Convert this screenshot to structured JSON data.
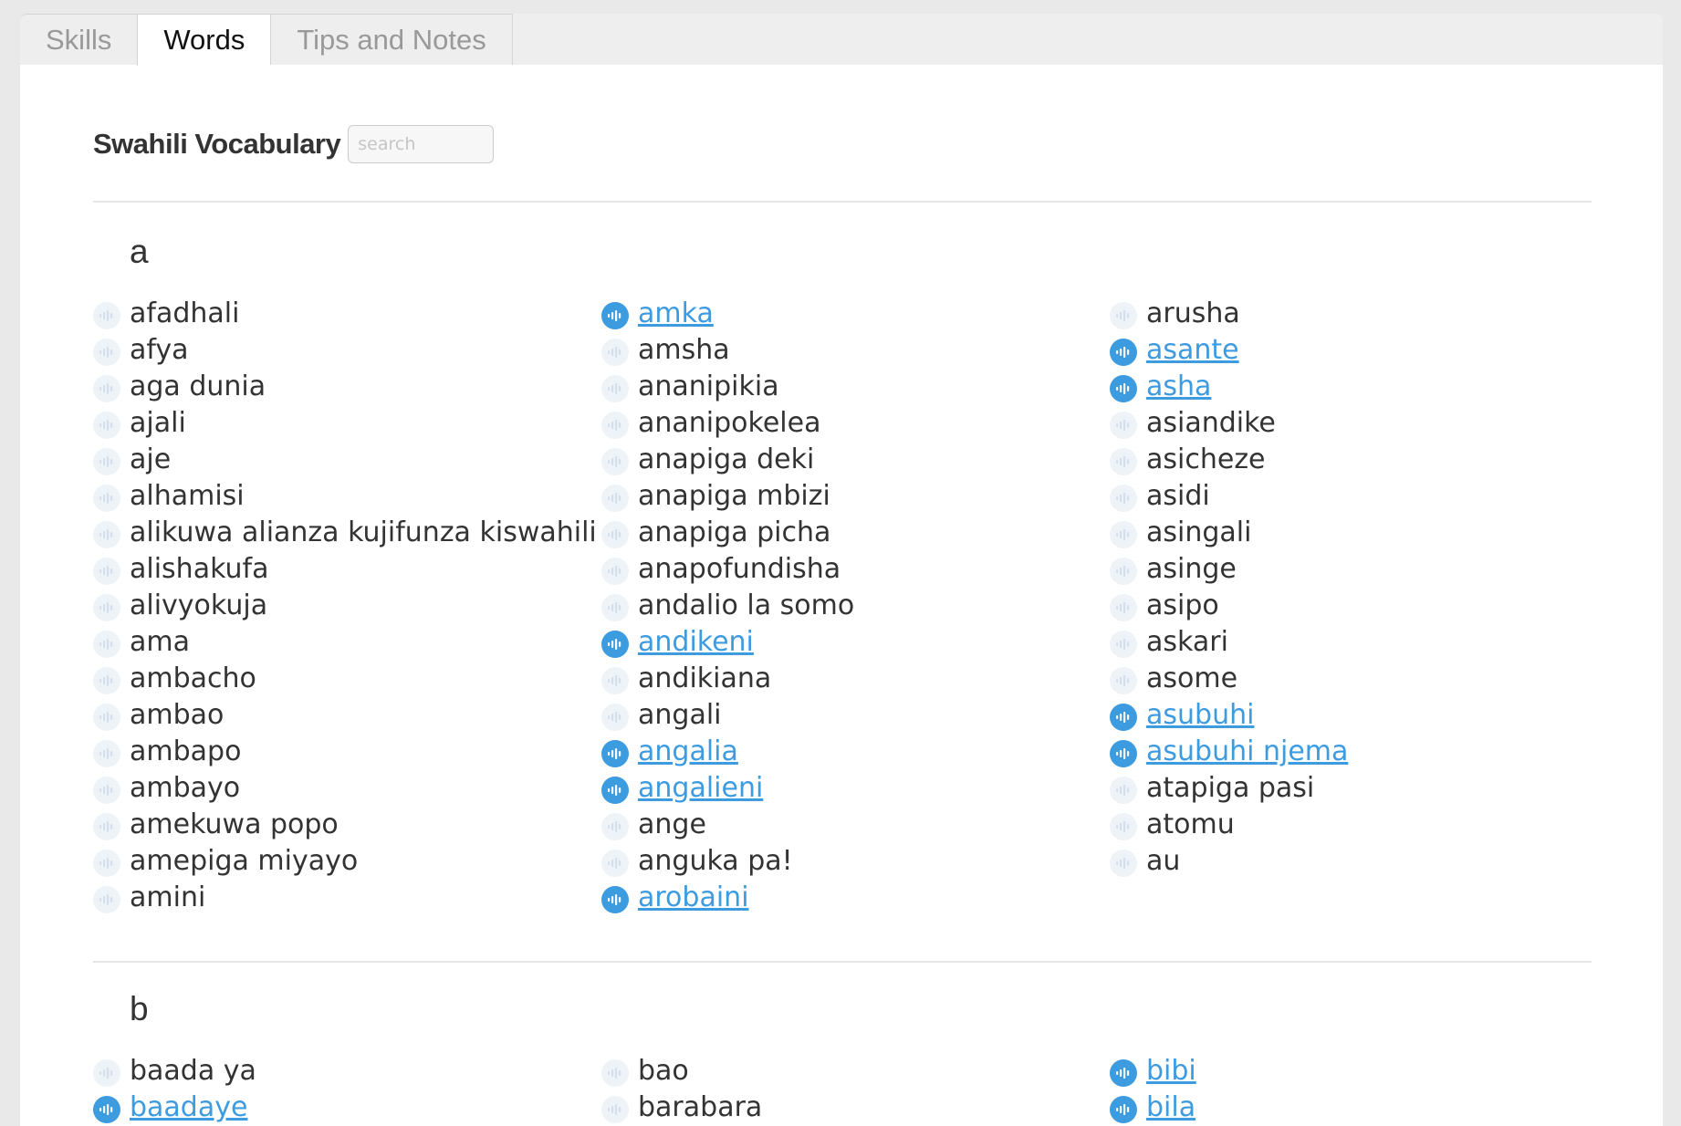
{
  "tabs": [
    {
      "label": "Skills",
      "active": false
    },
    {
      "label": "Words",
      "active": true
    },
    {
      "label": "Tips and Notes",
      "active": false
    }
  ],
  "header": {
    "title": "Swahili Vocabulary",
    "search_placeholder": "search"
  },
  "colors": {
    "link": "#3d9be0",
    "icon_inactive": "#eef3f8"
  },
  "sections": [
    {
      "letter": "a",
      "columns": [
        [
          {
            "text": "afadhali",
            "audio": false
          },
          {
            "text": "afya",
            "audio": false
          },
          {
            "text": "aga dunia",
            "audio": false
          },
          {
            "text": "ajali",
            "audio": false
          },
          {
            "text": "aje",
            "audio": false
          },
          {
            "text": "alhamisi",
            "audio": false
          },
          {
            "text": "alikuwa alianza kujifunza kiswahili",
            "audio": false
          },
          {
            "text": "alishakufa",
            "audio": false
          },
          {
            "text": "alivyokuja",
            "audio": false
          },
          {
            "text": "ama",
            "audio": false
          },
          {
            "text": "ambacho",
            "audio": false
          },
          {
            "text": "ambao",
            "audio": false
          },
          {
            "text": "ambapo",
            "audio": false
          },
          {
            "text": "ambayo",
            "audio": false
          },
          {
            "text": "amekuwa popo",
            "audio": false
          },
          {
            "text": "amepiga miyayo",
            "audio": false
          },
          {
            "text": "amini",
            "audio": false
          }
        ],
        [
          {
            "text": "amka",
            "audio": true
          },
          {
            "text": "amsha",
            "audio": false
          },
          {
            "text": "ananipikia",
            "audio": false
          },
          {
            "text": "ananipokelea",
            "audio": false
          },
          {
            "text": "anapiga deki",
            "audio": false
          },
          {
            "text": "anapiga mbizi",
            "audio": false
          },
          {
            "text": "anapiga picha",
            "audio": false
          },
          {
            "text": "anapofundisha",
            "audio": false
          },
          {
            "text": "andalio la somo",
            "audio": false
          },
          {
            "text": "andikeni",
            "audio": true
          },
          {
            "text": "andikiana",
            "audio": false
          },
          {
            "text": "angali",
            "audio": false
          },
          {
            "text": "angalia",
            "audio": true
          },
          {
            "text": "angalieni",
            "audio": true
          },
          {
            "text": "ange",
            "audio": false
          },
          {
            "text": "anguka pa!",
            "audio": false
          },
          {
            "text": "arobaini",
            "audio": true
          }
        ],
        [
          {
            "text": "arusha",
            "audio": false
          },
          {
            "text": "asante",
            "audio": true
          },
          {
            "text": "asha",
            "audio": true
          },
          {
            "text": "asiandike",
            "audio": false
          },
          {
            "text": "asicheze",
            "audio": false
          },
          {
            "text": "asidi",
            "audio": false
          },
          {
            "text": "asingali",
            "audio": false
          },
          {
            "text": "asinge",
            "audio": false
          },
          {
            "text": "asipo",
            "audio": false
          },
          {
            "text": "askari",
            "audio": false
          },
          {
            "text": "asome",
            "audio": false
          },
          {
            "text": "asubuhi",
            "audio": true
          },
          {
            "text": "asubuhi njema",
            "audio": true
          },
          {
            "text": "atapiga pasi",
            "audio": false
          },
          {
            "text": "atomu",
            "audio": false
          },
          {
            "text": "au",
            "audio": false
          }
        ]
      ]
    },
    {
      "letter": "b",
      "columns": [
        [
          {
            "text": "baada ya",
            "audio": false
          },
          {
            "text": "baadaye",
            "audio": true
          }
        ],
        [
          {
            "text": "bao",
            "audio": false
          },
          {
            "text": "barabara",
            "audio": false
          }
        ],
        [
          {
            "text": "bibi",
            "audio": true
          },
          {
            "text": "bila",
            "audio": true
          }
        ]
      ]
    }
  ]
}
